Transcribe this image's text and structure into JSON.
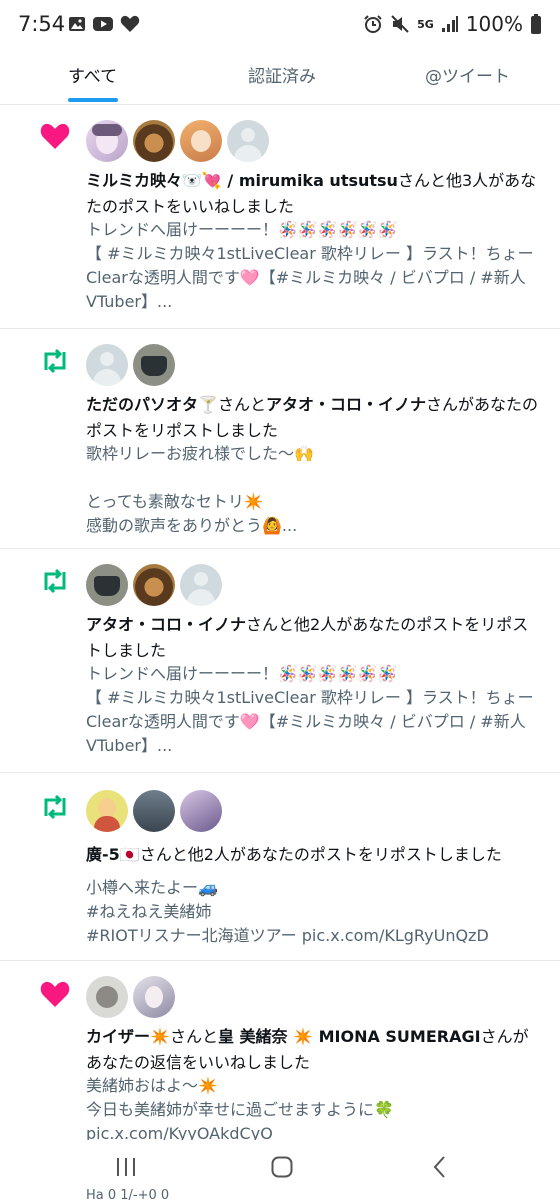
{
  "status_bar": {
    "time": "7:54",
    "network": "5G",
    "battery": "100%",
    "left_icons": [
      "image-icon",
      "youtube-icon",
      "heart-icon"
    ],
    "right_icons": [
      "alarm-icon",
      "mute-icon",
      "signal-icon",
      "battery-icon"
    ]
  },
  "tabs": [
    {
      "label": "すべて",
      "active": true
    },
    {
      "label": "認証済み",
      "active": false
    },
    {
      "label": "@ツイート",
      "active": false
    }
  ],
  "notifications": [
    {
      "type": "like",
      "icon": "heart-icon",
      "title_name": "ミルミカ映々🐻‍❄️💘 / mirumika utsutsu",
      "title_rest": "さんと他3人があなたのポストをいいねしました",
      "body": "トレンドへ届けーーーー！🪅🪅🪅🪅🪅🪅\n【 #ミルミカ映々1stLiveClear 歌枠リレー 】ラスト！ちょーClearな透明人間です🩷【#ミルミカ映々 / ビバプロ / #新人VTuber】..."
    },
    {
      "type": "repost",
      "icon": "repost-icon",
      "title_name": "ただのパソオタ🍸",
      "title_mid": "さんと",
      "title_name2": "アタオ・コロ・イノナ",
      "title_rest": "さんがあなたのポストをリポストしました",
      "body": "歌枠リレーお疲れ様でした〜🙌\n\nとっても素敵なセトリ✴️\n感動の歌声をありがとう🙆..."
    },
    {
      "type": "repost",
      "icon": "repost-icon",
      "title_name": "アタオ・コロ・イノナ",
      "title_rest": "さんと他2人があなたのポストをリポストしました",
      "body": "トレンドへ届けーーーー！🪅🪅🪅🪅🪅🪅\n【 #ミルミカ映々1stLiveClear 歌枠リレー 】ラスト！ちょーClearな透明人間です🩷【#ミルミカ映々 / ビバプロ / #新人VTuber】..."
    },
    {
      "type": "repost",
      "icon": "repost-icon",
      "title_name": "廣-5🇯🇵",
      "title_rest": "さんと他2人があなたのポストをリポストしました",
      "body": "小樽へ来たよー🚙\n#ねえねえ美緒姉\n#RIOTリスナー北海道ツアー pic.x.com/KLgRyUnQzD"
    },
    {
      "type": "like",
      "icon": "heart-icon",
      "title_name": "カイザー✴️",
      "title_mid": "さんと",
      "title_name2": "皇 美緒奈 ✴️ MIONA SUMERAGI",
      "title_rest": "さんがあなたの返信をいいねしました",
      "body": "美緒姉おはよ〜✴️\n今日も美緒姉が幸せに過ごせますように🍀 pic.x.com/KyyOAkdCyO"
    }
  ],
  "colors": {
    "like": "#f91880",
    "repost": "#00ba7c",
    "accent": "#1d9bf0",
    "secondary_text": "#536471"
  },
  "nav_bar": [
    "recents-icon",
    "home-icon",
    "back-icon"
  ],
  "peek_text": "Ha 0 1/-+0 0"
}
